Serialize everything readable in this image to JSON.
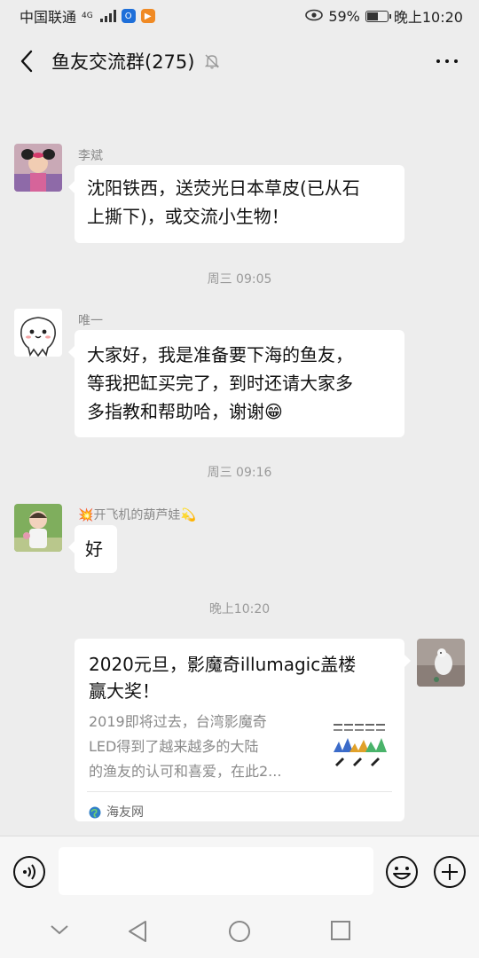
{
  "status_bar": {
    "carrier": "中国联通",
    "network": "4G",
    "battery_percent": "59%",
    "battery_level": 0.59,
    "time": "晚上10:20"
  },
  "header": {
    "title": "鱼友交流群(275)"
  },
  "messages": [
    {
      "sender": "李斌",
      "text_line1": "沈阳铁西，送荧光日本草皮(已从石",
      "text_line2": "上撕下)，或交流小生物！"
    },
    {
      "sender": "唯一",
      "text_line1": "大家好，我是准备要下海的鱼友，",
      "text_line2": "等我把缸买完了，到时还请大家多",
      "text_line3": "多指教和帮助哈，谢谢😁"
    },
    {
      "sender": "开飞机的葫芦娃",
      "sender_prefix_emoji": "💥",
      "sender_suffix_emoji": "💫",
      "text": "好"
    }
  ],
  "timestamps": [
    "周三 09:05",
    "周三 09:16",
    "晚上10:20"
  ],
  "link_card": {
    "title_line1": "2020元旦，影魔奇illumagic盖楼",
    "title_line2": "赢大奖！",
    "desc_line1": "2019即将过去，台湾影魔奇",
    "desc_line2": "LED得到了越来越多的大陆",
    "desc_line3": "的渔友的认可和喜爱，在此2...",
    "source": "海友网"
  },
  "colors": {
    "background": "#ededed",
    "bubble": "#ffffff",
    "meta_text": "#9a9a9a"
  }
}
